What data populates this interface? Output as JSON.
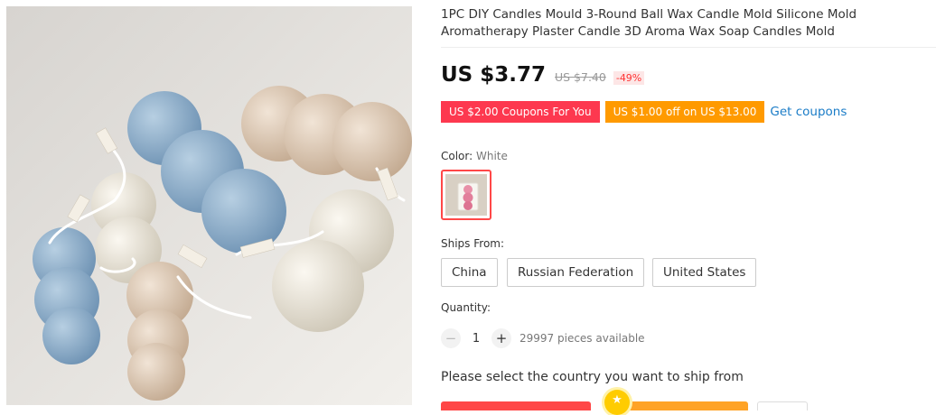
{
  "product": {
    "title": "1PC DIY Candles Mould 3-Round Ball Wax Candle Mold Silicone Mold Aromatherapy Plaster Candle 3D Aroma Wax Soap Candles Mold",
    "image_icon": "candle-product-photo"
  },
  "pricing": {
    "price": "US $3.77",
    "original_price": "US $7.40",
    "discount": "-49%"
  },
  "coupons": {
    "items": [
      "US $2.00 Coupons For You",
      "US $1.00 off on US $13.00"
    ],
    "get_label": "Get coupons",
    "colors": {
      "red": "#fd384f",
      "orange": "#ff9a00",
      "link": "#1a7cc7"
    }
  },
  "color": {
    "label": "Color:",
    "selected": "White"
  },
  "shipping": {
    "label": "Ships From:",
    "options": [
      "China",
      "Russian Federation",
      "United States"
    ]
  },
  "quantity": {
    "label": "Quantity:",
    "value": "1",
    "available": "29997 pieces available",
    "minus_icon": "minus-icon",
    "plus_icon": "plus-icon"
  },
  "ship_note": "Please select the country you want to ship from",
  "buttons": {
    "buy_color": "#ff4747",
    "cart_color": "#ffa326"
  }
}
